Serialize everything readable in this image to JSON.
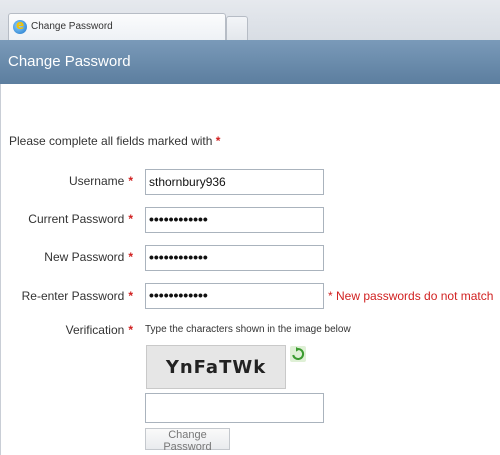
{
  "browser": {
    "tab_title": "Change Password"
  },
  "header": {
    "title": "Change Password"
  },
  "form": {
    "instruction": "Please complete all fields marked with",
    "required_marker": "*",
    "fields": {
      "username": {
        "label": "Username",
        "value": "sthornbury936"
      },
      "current_password": {
        "label": "Current Password",
        "value": "••••••••••••"
      },
      "new_password": {
        "label": "New Password",
        "value": "••••••••••••"
      },
      "reenter_password": {
        "label": "Re-enter Password",
        "value": "••••••••••••"
      }
    },
    "error_message": "* New passwords do not match",
    "verification": {
      "label": "Verification",
      "hint": "Type the characters shown in the image below",
      "captcha_text": "YnFaTWk",
      "input_value": ""
    },
    "submit_label": "Change Password"
  },
  "icons": {
    "browser_tab": "internet-explorer-icon",
    "captcha_refresh": "refresh-icon"
  },
  "colors": {
    "header_bg": "#6a8aab",
    "required": "#d12121",
    "error": "#d12121"
  }
}
